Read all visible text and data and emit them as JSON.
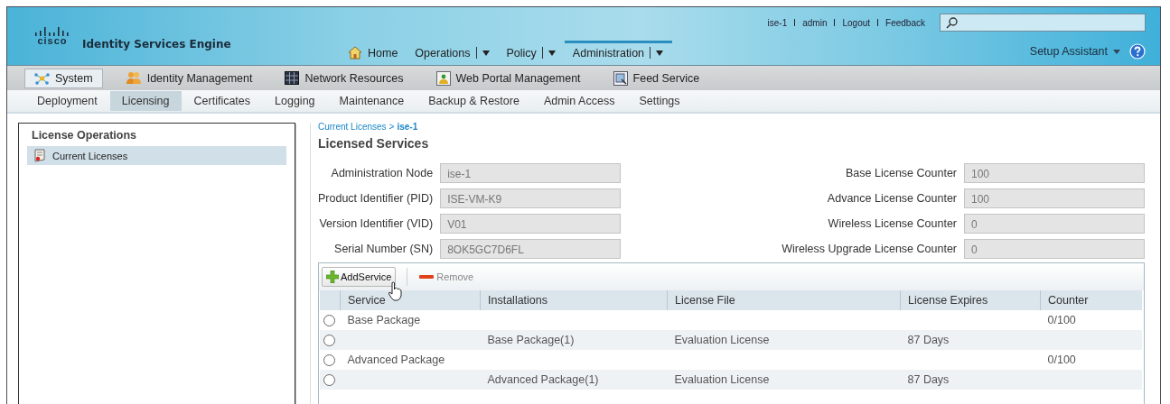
{
  "header": {
    "logo_text": "cisco",
    "product": "Identity Services Engine",
    "top_links": [
      "ise-1",
      "admin",
      "Logout",
      "Feedback"
    ],
    "nav": [
      {
        "label": "Home",
        "kind": "home",
        "selected": false
      },
      {
        "label": "Operations",
        "kind": "dropdown",
        "selected": false
      },
      {
        "label": "Policy",
        "kind": "dropdown",
        "selected": false
      },
      {
        "label": "Administration",
        "kind": "dropdown",
        "selected": true
      }
    ],
    "setup_assistant": "Setup Assistant"
  },
  "menu_tabs": [
    {
      "label": "System",
      "kind": "network",
      "selected": true
    },
    {
      "label": "Identity Management",
      "kind": "users",
      "selected": false
    },
    {
      "label": "Network Resources",
      "kind": "rack",
      "selected": false
    },
    {
      "label": "Web Portal Management",
      "kind": "portal",
      "selected": false
    },
    {
      "label": "Feed Service",
      "kind": "feed",
      "selected": false
    }
  ],
  "sub_nav": [
    {
      "label": "Deployment",
      "selected": false
    },
    {
      "label": "Licensing",
      "selected": true
    },
    {
      "label": "Certificates",
      "selected": false
    },
    {
      "label": "Logging",
      "selected": false
    },
    {
      "label": "Maintenance",
      "selected": false
    },
    {
      "label": "Backup & Restore",
      "selected": false
    },
    {
      "label": "Admin Access",
      "selected": false
    },
    {
      "label": "Settings",
      "selected": false
    }
  ],
  "sidebar": {
    "title": "License Operations",
    "items": [
      {
        "label": "Current Licenses",
        "selected": true
      }
    ]
  },
  "breadcrumb": [
    {
      "label": "Current Licenses",
      "kind": "link"
    },
    {
      "label": ">",
      "kind": "separator"
    },
    {
      "label": "ise-1",
      "kind": "current"
    }
  ],
  "page_title": "Licensed Services",
  "fields_left": [
    {
      "label": "Administration Node",
      "value": "ise-1"
    },
    {
      "label": "Product Identifier (PID)",
      "value": "ISE-VM-K9"
    },
    {
      "label": "Version Identifier (VID)",
      "value": "V01"
    },
    {
      "label": "Serial Number (SN)",
      "value": "8OK5GC7D6FL"
    }
  ],
  "fields_right": [
    {
      "label": "Base License Counter",
      "value": "100"
    },
    {
      "label": "Advance License Counter",
      "value": "100"
    },
    {
      "label": "Wireless License Counter",
      "value": "0"
    },
    {
      "label": "Wireless Upgrade License Counter",
      "value": "0"
    }
  ],
  "toolbar": [
    {
      "label": "AddService",
      "kind": "add",
      "disabled": false
    },
    {
      "label": "Remove",
      "kind": "remove",
      "disabled": true
    }
  ],
  "table": {
    "columns": [
      "Service",
      "Installations",
      "License File",
      "License Expires",
      "Counter"
    ],
    "rows": [
      {
        "selected": false,
        "service": "Base Package",
        "counter": "0/100"
      },
      {
        "selected": false,
        "installations": "Base Package(1)",
        "license_file": "Evaluation License",
        "license_expires": "87 Days"
      },
      {
        "selected": false,
        "service": "Advanced Package",
        "counter": "0/100"
      },
      {
        "selected": false,
        "installations": "Advanced Package(1)",
        "license_file": "Evaluation License",
        "license_expires": "87 Days"
      }
    ]
  }
}
